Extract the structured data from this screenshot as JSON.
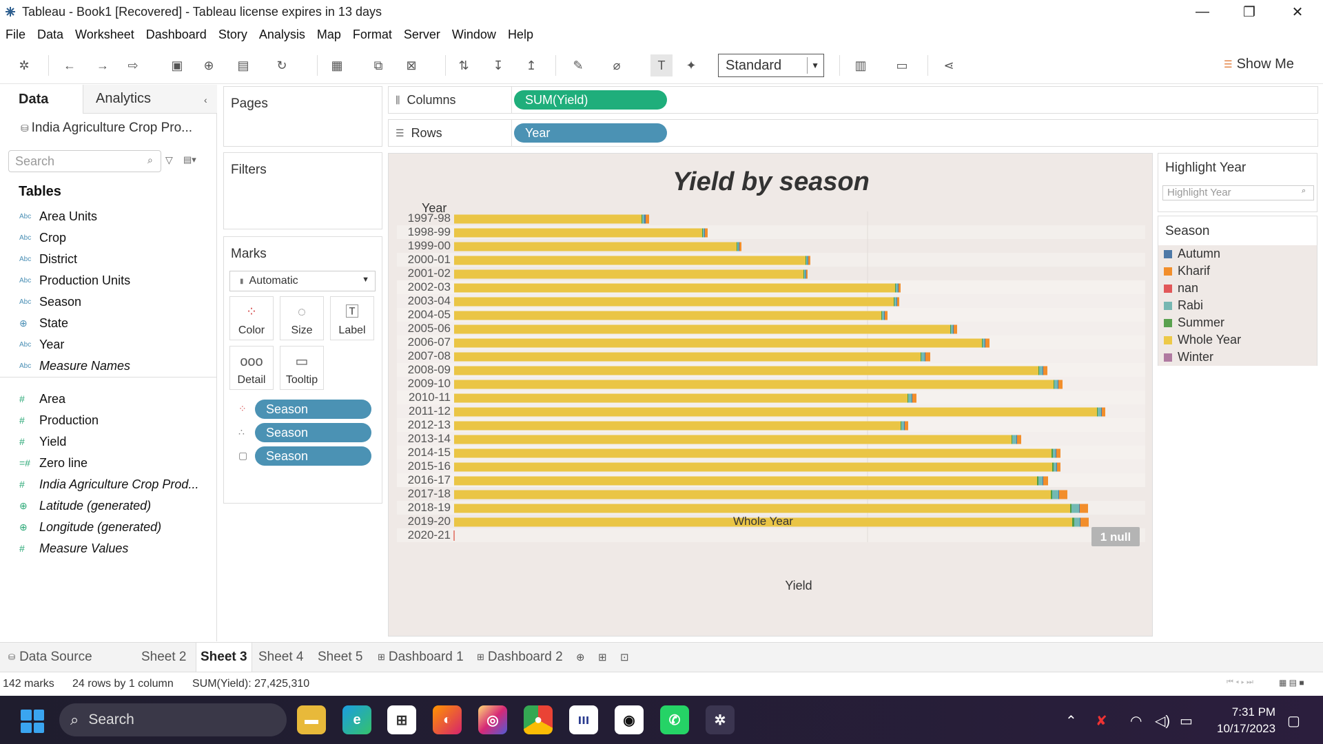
{
  "window": {
    "title": "Tableau - Book1 [Recovered] - Tableau license expires in 13 days",
    "minimize": "—",
    "restore": "❐",
    "close": "✕"
  },
  "menu": [
    "File",
    "Data",
    "Worksheet",
    "Dashboard",
    "Story",
    "Analysis",
    "Map",
    "Format",
    "Server",
    "Window",
    "Help"
  ],
  "toolbar": {
    "fit_select": "Standard",
    "show_me": "Show Me"
  },
  "data_pane": {
    "tab_data": "Data",
    "tab_analytics": "Analytics",
    "datasource": "India Agriculture Crop Pro...",
    "search_placeholder": "Search",
    "tables_heading": "Tables",
    "dimensions": [
      {
        "name": "Area Units",
        "type": "Abc"
      },
      {
        "name": "Crop",
        "type": "Abc"
      },
      {
        "name": "District",
        "type": "Abc"
      },
      {
        "name": "Production Units",
        "type": "Abc"
      },
      {
        "name": "Season",
        "type": "Abc"
      },
      {
        "name": "State",
        "type": "geo"
      },
      {
        "name": "Year",
        "type": "Abc"
      },
      {
        "name": "Measure Names",
        "type": "Abc"
      }
    ],
    "measures": [
      {
        "name": "Area"
      },
      {
        "name": "Production"
      },
      {
        "name": "Yield"
      },
      {
        "name": "Zero line"
      },
      {
        "name": "India Agriculture Crop Prod..."
      },
      {
        "name": "Latitude (generated)"
      },
      {
        "name": "Longitude (generated)"
      },
      {
        "name": "Measure Values"
      }
    ]
  },
  "cards": {
    "pages": "Pages",
    "filters": "Filters",
    "marks": "Marks",
    "marks_type": "Automatic",
    "buttons": [
      "Color",
      "Size",
      "Label",
      "Detail",
      "Tooltip"
    ],
    "pills": [
      "Season",
      "Season",
      "Season"
    ]
  },
  "shelves": {
    "columns_label": "Columns",
    "columns_pill": "SUM(Yield)",
    "rows_label": "Rows",
    "rows_pill": "Year"
  },
  "chart_data": {
    "type": "bar",
    "orientation": "horizontal",
    "stacked": true,
    "title": "Yield by season",
    "ylabel": "Year",
    "xlabel": "Yield",
    "categories": [
      "1997-98",
      "1998-99",
      "1999-00",
      "2000-01",
      "2001-02",
      "2002-03",
      "2003-04",
      "2004-05",
      "2005-06",
      "2006-07",
      "2007-08",
      "2008-09",
      "2009-10",
      "2010-11",
      "2011-12",
      "2012-13",
      "2013-14",
      "2014-15",
      "2015-16",
      "2016-17",
      "2017-18",
      "2018-19",
      "2019-20",
      "2020-21"
    ],
    "series": [
      {
        "name": "Whole Year",
        "color": "#eac545",
        "values": [
          272,
          360,
          410,
          510,
          507,
          640,
          638,
          620,
          720,
          766,
          677,
          848,
          870,
          658,
          933,
          648,
          809,
          867,
          868,
          846,
          866,
          894,
          897,
          0
        ]
      },
      {
        "name": "Summer",
        "color": "#4f9e45",
        "values": [
          1,
          1,
          1,
          1,
          1,
          1,
          1,
          1,
          1,
          1,
          1,
          1,
          1,
          1,
          1,
          1,
          1,
          2,
          2,
          2,
          2,
          2,
          3,
          0
        ]
      },
      {
        "name": "Rabi",
        "color": "#73b9b3",
        "values": [
          3,
          2,
          2,
          2,
          2,
          3,
          3,
          3,
          3,
          3,
          5,
          5,
          5,
          5,
          5,
          4,
          6,
          4,
          4,
          6,
          9,
          11,
          8,
          0
        ]
      },
      {
        "name": "Autumn",
        "color": "#4e79a7",
        "values": [
          2,
          1,
          1,
          1,
          1,
          1,
          1,
          1,
          1,
          1,
          1,
          1,
          1,
          1,
          1,
          1,
          1,
          1,
          1,
          1,
          1,
          1,
          1,
          0
        ]
      },
      {
        "name": "Kharif",
        "color": "#f28e2b",
        "values": [
          5,
          4,
          3,
          3,
          2,
          3,
          3,
          4,
          5,
          6,
          7,
          6,
          6,
          6,
          5,
          5,
          6,
          6,
          5,
          7,
          12,
          12,
          12,
          0
        ]
      }
    ],
    "xlim": [
      0,
      1000
    ],
    "annotations": [
      "Whole Year",
      "1 null"
    ]
  },
  "legend": {
    "highlight_title": "Highlight Year",
    "highlight_placeholder": "Highlight Year",
    "season_title": "Season",
    "items": [
      {
        "name": "Autumn",
        "color": "#4e79a7"
      },
      {
        "name": "Kharif",
        "color": "#f28e2b"
      },
      {
        "name": "nan",
        "color": "#e15759"
      },
      {
        "name": "Rabi",
        "color": "#76b7b2"
      },
      {
        "name": "Summer",
        "color": "#59a14f"
      },
      {
        "name": "Whole Year",
        "color": "#edc948"
      },
      {
        "name": "Winter",
        "color": "#b07aa1"
      }
    ]
  },
  "sheet_tabs": {
    "datasource": "Data Source",
    "tabs": [
      "Sheet 2",
      "Sheet 3",
      "Sheet 4",
      "Sheet 5",
      "Dashboard 1",
      "Dashboard 2"
    ],
    "active": "Sheet 3"
  },
  "status": {
    "marks": "142 marks",
    "rows": "24 rows by 1 column",
    "sum": "SUM(Yield): 27,425,310"
  },
  "taskbar": {
    "search": "Search",
    "time": "7:31 PM",
    "date": "10/17/2023"
  }
}
